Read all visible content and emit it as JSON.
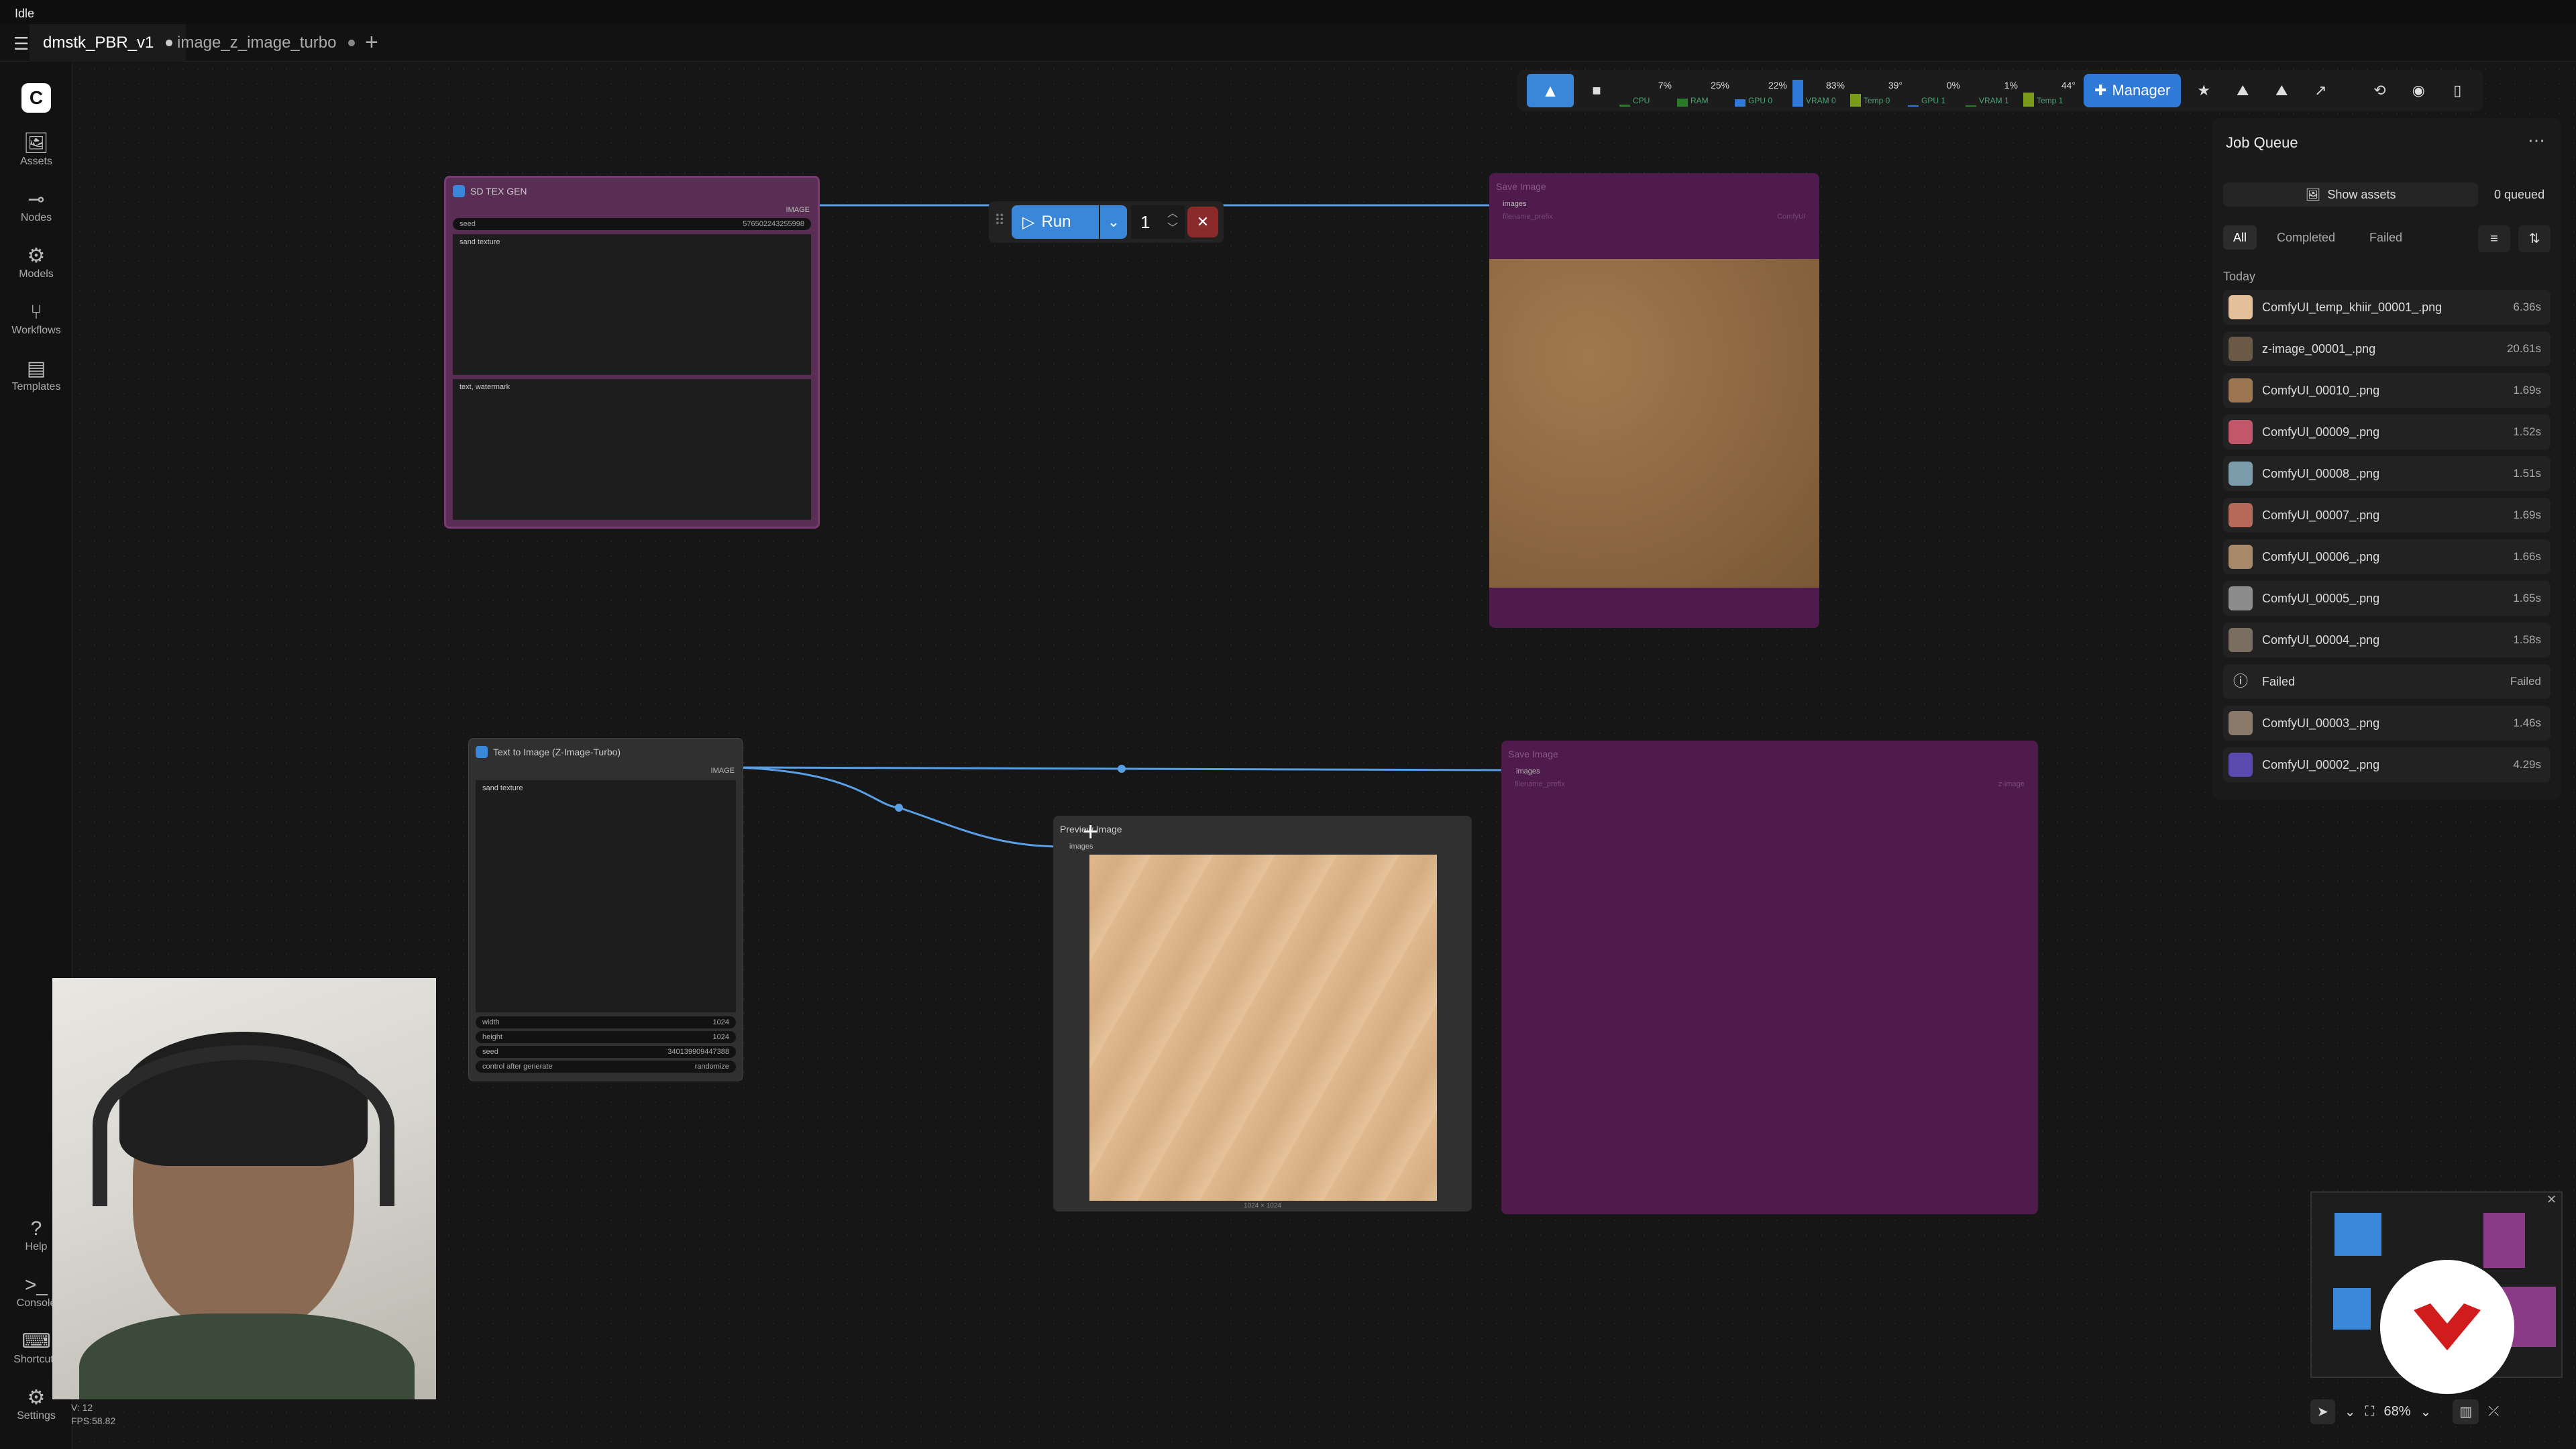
{
  "titlebar": {
    "status": "Idle"
  },
  "tabs": [
    {
      "label": "dmstk_PBR_v1"
    },
    {
      "label": "image_z_image_turbo"
    }
  ],
  "sidebar": {
    "items": [
      {
        "label": "Assets",
        "icon": "image-icon"
      },
      {
        "label": "Nodes",
        "icon": "nodes-icon"
      },
      {
        "label": "Models",
        "icon": "models-icon"
      },
      {
        "label": "Workflows",
        "icon": "workflow-icon"
      },
      {
        "label": "Templates",
        "icon": "template-icon"
      }
    ],
    "bottom_items": [
      {
        "label": "Help",
        "icon": "help-icon"
      },
      {
        "label": "Console",
        "icon": "terminal-icon"
      },
      {
        "label": "Shortcuts",
        "icon": "keyboard-icon"
      },
      {
        "label": "Settings",
        "icon": "gear-icon"
      }
    ],
    "version": "V: 12",
    "fps": "FPS:58.82"
  },
  "monitor": [
    {
      "label": "CPU",
      "value": "7%",
      "level": 0.07
    },
    {
      "label": "RAM",
      "value": "25%",
      "level": 0.25
    },
    {
      "label": "GPU 0",
      "value": "22%",
      "level": 0.22
    },
    {
      "label": "VRAM 0",
      "value": "83%",
      "level": 0.83
    },
    {
      "label": "Temp 0",
      "value": "39°",
      "level": 0.39
    },
    {
      "label": "GPU 1",
      "value": "0%",
      "level": 0.0
    },
    {
      "label": "VRAM 1",
      "value": "1%",
      "level": 0.01
    },
    {
      "label": "Temp 1",
      "value": "44°",
      "level": 0.44
    }
  ],
  "toolbar": {
    "manager_label": "Manager"
  },
  "run": {
    "label": "Run",
    "count": "1"
  },
  "nodes": {
    "sd_tex_gen": {
      "title": "SD TEX GEN",
      "output": "IMAGE",
      "seed_label": "seed",
      "seed_value": "576502243255998",
      "positive": "sand texture",
      "negative": "text, watermark"
    },
    "save_image_top": {
      "title": "Save Image",
      "input": "images",
      "prefix_label": "filename_prefix",
      "prefix_value": "ComfyUI"
    },
    "text_to_image": {
      "title": "Text to Image (Z-Image-Turbo)",
      "output": "IMAGE",
      "prompt": "sand texture",
      "widgets": [
        {
          "label": "width",
          "value": "1024"
        },
        {
          "label": "height",
          "value": "1024"
        },
        {
          "label": "seed",
          "value": "340139909447388"
        },
        {
          "label": "control after generate",
          "value": "randomize"
        }
      ]
    },
    "preview_image": {
      "title": "Preview Image",
      "input": "images",
      "size": "1024 × 1024"
    },
    "save_image_bottom": {
      "title": "Save Image",
      "input": "images",
      "prefix_label": "filename_prefix",
      "prefix_value": "z-image"
    }
  },
  "queue": {
    "title": "Job Queue",
    "show_assets": "Show assets",
    "queued": "0 queued",
    "filters": [
      "All",
      "Completed",
      "Failed"
    ],
    "section": "Today",
    "jobs": [
      {
        "name": "ComfyUI_temp_khiir_00001_.png",
        "time": "6.36s",
        "color": "#e3c09a"
      },
      {
        "name": "z-image_00001_.png",
        "time": "20.61s",
        "color": "#6a5a45"
      },
      {
        "name": "ComfyUI_00010_.png",
        "time": "1.69s",
        "color": "#9c7650"
      },
      {
        "name": "ComfyUI_00009_.png",
        "time": "1.52s",
        "color": "#c2566a"
      },
      {
        "name": "ComfyUI_00008_.png",
        "time": "1.51s",
        "color": "#7a9cab"
      },
      {
        "name": "ComfyUI_00007_.png",
        "time": "1.69s",
        "color": "#b86a5a"
      },
      {
        "name": "ComfyUI_00006_.png",
        "time": "1.66s",
        "color": "#a88a6a"
      },
      {
        "name": "ComfyUI_00005_.png",
        "time": "1.65s",
        "color": "#8c8c8c"
      },
      {
        "name": "ComfyUI_00004_.png",
        "time": "1.58s",
        "color": "#7a6e62"
      },
      {
        "name": "Failed",
        "time": "Failed",
        "color": ""
      },
      {
        "name": "ComfyUI_00003_.png",
        "time": "1.46s",
        "color": "#8a7a6a"
      },
      {
        "name": "ComfyUI_00002_.png",
        "time": "4.29s",
        "color": "#5a4ab0"
      }
    ]
  },
  "zoom": "68%"
}
